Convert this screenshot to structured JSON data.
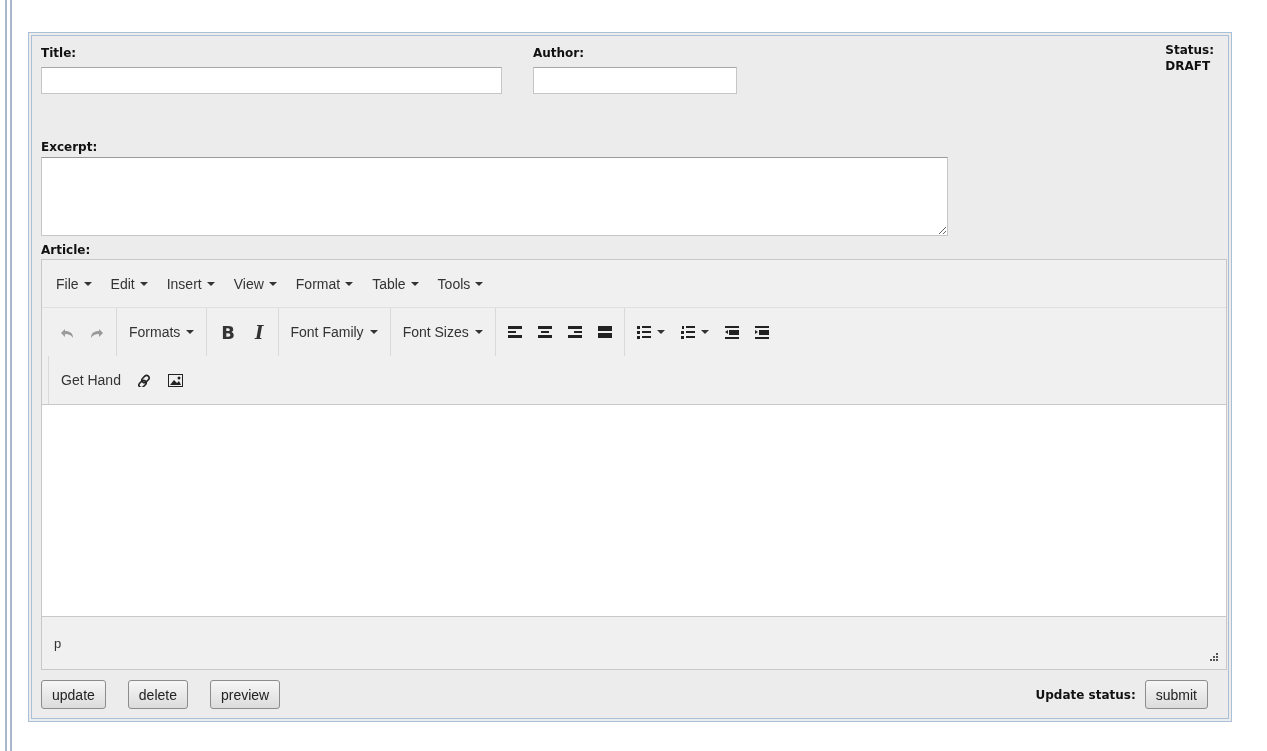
{
  "fields": [
    {
      "label": "Title:"
    },
    {
      "label": "Author:"
    }
  ],
  "status": {
    "label": "Status:",
    "value": "DRAFT"
  },
  "excerpt": {
    "label": "Excerpt:"
  },
  "article": {
    "label": "Article:",
    "menus": [
      "File",
      "Edit",
      "Insert",
      "View",
      "Format",
      "Table",
      "Tools"
    ],
    "toolbar_rows": [
      [
        [
          {
            "kind": "undo",
            "disabled": true
          },
          {
            "kind": "redo",
            "disabled": true
          }
        ],
        [
          {
            "kind": "dropdown",
            "text": "Formats"
          }
        ],
        [
          {
            "kind": "bold",
            "text": "B"
          },
          {
            "kind": "italic",
            "text": "I"
          }
        ],
        [
          {
            "kind": "dropdown",
            "text": "Font Family"
          }
        ],
        [
          {
            "kind": "dropdown",
            "text": "Font Sizes"
          }
        ],
        [
          {
            "kind": "alignleft"
          },
          {
            "kind": "aligncenter"
          },
          {
            "kind": "alignright"
          },
          {
            "kind": "justify"
          }
        ],
        [
          {
            "kind": "bullist"
          },
          {
            "kind": "numlist"
          },
          {
            "kind": "outdent"
          },
          {
            "kind": "indent"
          }
        ]
      ],
      [
        [
          {
            "kind": "textbutton",
            "text": "Get Hand"
          },
          {
            "kind": "link"
          },
          {
            "kind": "image"
          }
        ]
      ]
    ],
    "path": "p"
  },
  "buttons": [
    "update",
    "delete",
    "preview"
  ],
  "update_status": {
    "label": "Update status:",
    "button": "submit"
  }
}
